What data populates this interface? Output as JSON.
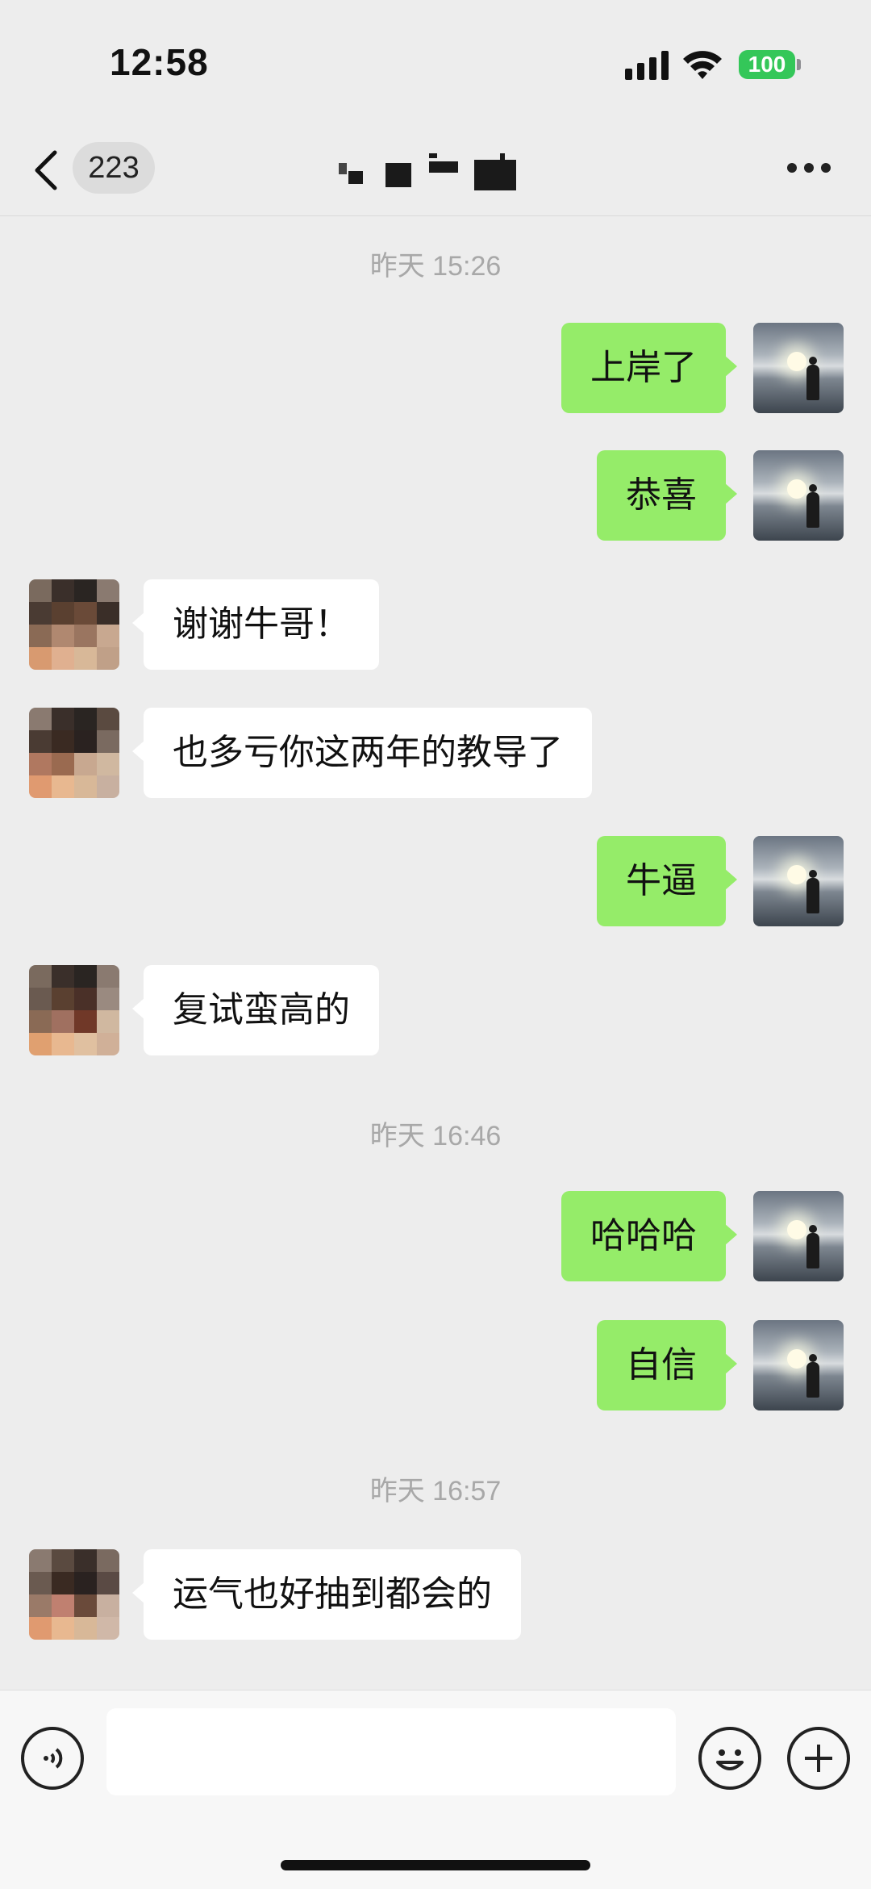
{
  "status_bar": {
    "time": "12:58",
    "battery": "100"
  },
  "nav": {
    "unread_count": "223"
  },
  "separators": [
    "昨天 15:26",
    "昨天 16:46",
    "昨天 16:57"
  ],
  "messages": [
    {
      "from": "me",
      "text": "上岸了"
    },
    {
      "from": "me",
      "text": "恭喜"
    },
    {
      "from": "other",
      "text": "谢谢牛哥！"
    },
    {
      "from": "other",
      "text": "也多亏你这两年的教导了"
    },
    {
      "from": "me",
      "text": "牛逼"
    },
    {
      "from": "other",
      "text": "复试蛮高的"
    },
    {
      "from": "me",
      "text": "哈哈哈"
    },
    {
      "from": "me",
      "text": "自信"
    },
    {
      "from": "other",
      "text": "运气也好抽到都会的"
    }
  ],
  "colors": {
    "my_bubble": "#95ec69",
    "other_bubble": "#ffffff",
    "background": "#ededed",
    "battery": "#34c759"
  },
  "icons": [
    "back-chevron-icon",
    "more-icon",
    "voice-icon",
    "emoji-icon",
    "plus-icon"
  ]
}
